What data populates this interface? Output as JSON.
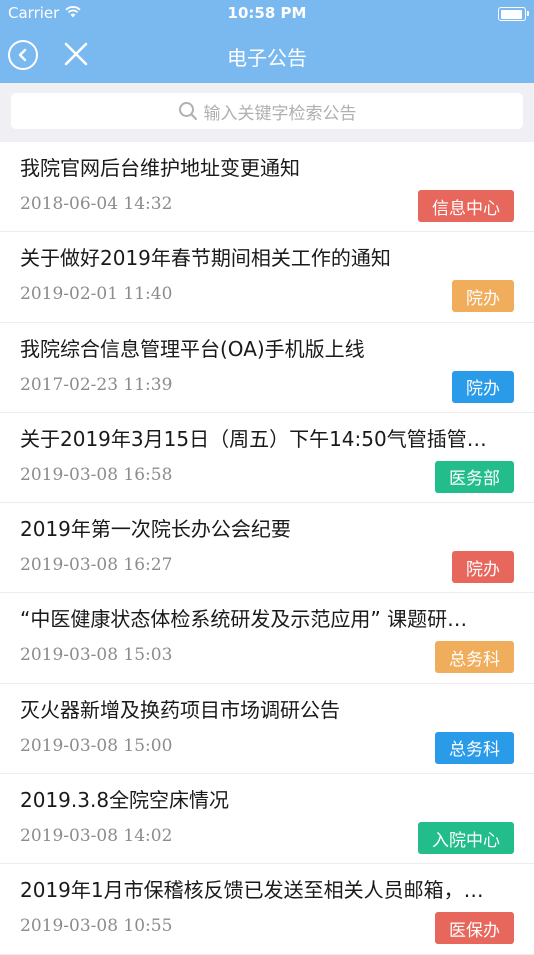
{
  "status_bar": {
    "carrier": "Carrier",
    "time": "10:58 PM"
  },
  "nav": {
    "title": "电子公告"
  },
  "search": {
    "placeholder": "输入关键字检索公告"
  },
  "items": [
    {
      "title": "我院官网后台维护地址变更通知",
      "date": "2018-06-04 14:32",
      "tag": "信息中心",
      "tag_color": "#e8675c"
    },
    {
      "title": "关于做好2019年春节期间相关工作的通知",
      "date": "2019-02-01 11:40",
      "tag": "院办",
      "tag_color": "#f0ad5b"
    },
    {
      "title": "我院综合信息管理平台(OA)手机版上线",
      "date": "2017-02-23 11:39",
      "tag": "院办",
      "tag_color": "#2a9be9"
    },
    {
      "title": "关于2019年3月15日（周五）下午14:50气管插管…",
      "date": "2019-03-08 16:58",
      "tag": "医务部",
      "tag_color": "#22bd8a"
    },
    {
      "title": "2019年第一次院长办公会纪要",
      "date": "2019-03-08 16:27",
      "tag": "院办",
      "tag_color": "#e8675c"
    },
    {
      "title": "“中医健康状态体检系统研发及示范应用” 课题研…",
      "date": "2019-03-08 15:03",
      "tag": "总务科",
      "tag_color": "#f0ad5b"
    },
    {
      "title": "灭火器新增及换药项目市场调研公告",
      "date": "2019-03-08 15:00",
      "tag": "总务科",
      "tag_color": "#2a9be9"
    },
    {
      "title": "2019.3.8全院空床情况",
      "date": "2019-03-08 14:02",
      "tag": "入院中心",
      "tag_color": "#22bd8a"
    },
    {
      "title": "2019年1月市保稽核反馈已发送至相关人员邮箱，…",
      "date": "2019-03-08 10:55",
      "tag": "医保办",
      "tag_color": "#e8675c"
    }
  ]
}
